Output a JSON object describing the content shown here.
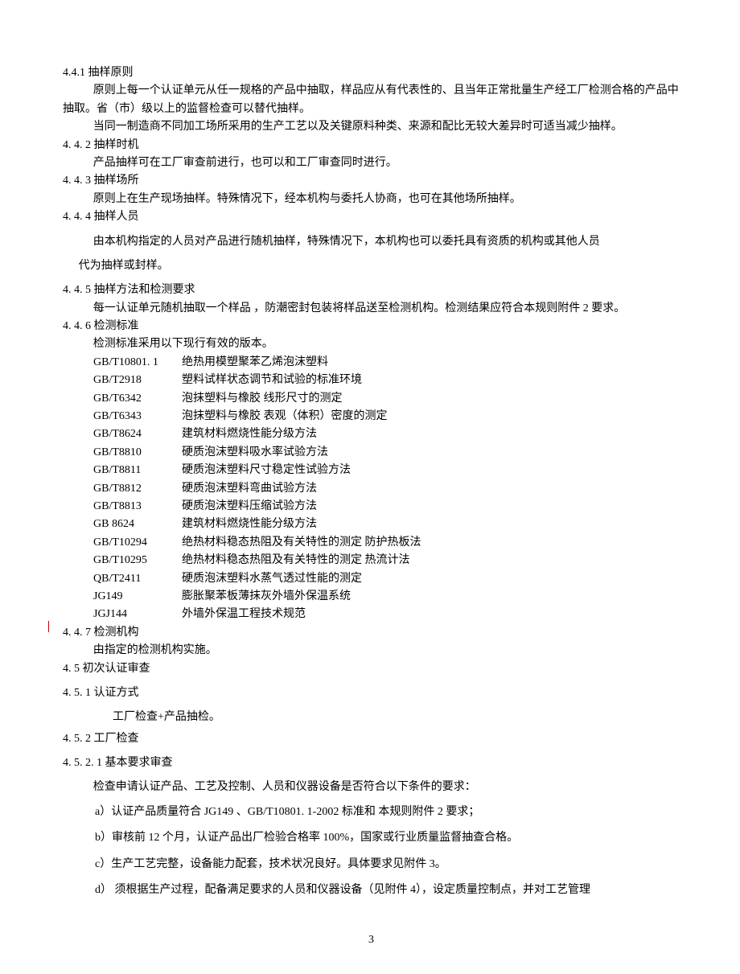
{
  "s441": {
    "heading": "4.4.1 抽样原则",
    "p1": "原则上每一个认证单元从任一规格的产品中抽取，样品应从有代表性的、且当年正常批量生产经工厂检测合格的产品中抽取。省（市）级以上的监督检查可以替代抽样。",
    "p2": "当同一制造商不同加工场所采用的生产工艺以及关键原料种类、来源和配比无较大差异时可适当减少抽样。"
  },
  "s442": {
    "heading": "4. 4. 2 抽样时机",
    "p1": "产品抽样可在工厂审查前进行，也可以和工厂审查同时进行。"
  },
  "s443": {
    "heading": "4. 4. 3  抽样场所",
    "p1": "原则上在生产现场抽样。特殊情况下，经本机构与委托人协商，也可在其他场所抽样。"
  },
  "s444": {
    "heading": "4. 4. 4 抽样人员",
    "p1": "由本机构指定的人员对产品进行随机抽样，特殊情况下，本机构也可以委托具有资质的机构或其他人员",
    "p2": "代为抽样或封样。"
  },
  "s445": {
    "heading": "4. 4. 5 抽样方法和检测要求",
    "p1": "每一认证单元随机抽取一个样品 ，防潮密封包装将样品送至检测机构。检测结果应符合本规则附件 2 要求。"
  },
  "s446": {
    "heading": "4. 4. 6 检测标准",
    "intro": "检测标准采用以下现行有效的版本。",
    "standards": [
      {
        "code": "GB/T10801. 1",
        "title": "绝热用模塑聚苯乙烯泡沫塑料"
      },
      {
        "code": "GB/T2918",
        "title": "塑料试样状态调节和试验的标准环境"
      },
      {
        "code": "GB/T6342",
        "title": "泡抹塑料与橡胶  线形尺寸的测定"
      },
      {
        "code": "GB/T6343",
        "title": "泡抹塑料与橡胶  表观（体积）密度的测定"
      },
      {
        "code": "GB/T8624",
        "title": "建筑材料燃烧性能分级方法"
      },
      {
        "code": "GB/T8810",
        "title": "硬质泡沫塑料吸水率试验方法"
      },
      {
        "code": "GB/T8811",
        "title": "硬质泡沫塑料尺寸稳定性试验方法"
      },
      {
        "code": "GB/T8812",
        "title": "硬质泡沫塑料弯曲试验方法"
      },
      {
        "code": "GB/T8813",
        "title": "硬质泡沫塑料压缩试验方法"
      },
      {
        "code": "GB 8624",
        "title": "建筑材料燃烧性能分级方法"
      },
      {
        "code": "GB/T10294",
        "title": "绝热材料稳态热阻及有关特性的测定  防护热板法"
      },
      {
        "code": "GB/T10295",
        "title": "绝热材料稳态热阻及有关特性的测定  热流计法"
      },
      {
        "code": "QB/T2411",
        "title": "硬质泡沫塑料水蒸气透过性能的测定"
      },
      {
        "code": "JG149",
        "title": "膨胀聚苯板薄抹灰外墙外保温系统"
      },
      {
        "code": "JGJ144",
        "title": "外墙外保温工程技术规范"
      }
    ]
  },
  "s447": {
    "heading": "4. 4. 7 检测机构",
    "p1": "由指定的检测机构实施。"
  },
  "s45": {
    "heading": "4. 5 初次认证审查"
  },
  "s451": {
    "heading": "4. 5. 1  认证方式",
    "p1": "工厂检查+产品抽检。"
  },
  "s452": {
    "heading": "4. 5. 2 工厂检查"
  },
  "s4521": {
    "heading": "4. 5. 2. 1 基本要求审查",
    "p1": "检查申请认证产品、工艺及控制、人员和仪器设备是否符合以下条件的要求：",
    "items": [
      "a）认证产品质量符合 JG149 、GB/T10801. 1-2002 标准和  本规则附件 2 要求；",
      "b）审核前 12 个月，认证产品出厂检验合格率 100%，国家或行业质量监督抽查合格。",
      "c）生产工艺完整，设备能力配套，技术状况良好。具体要求见附件 3。",
      "d） 须根据生产过程，配备满足要求的人员和仪器设备（见附件 4），设定质量控制点，并对工艺管理"
    ]
  },
  "pageNumber": "3"
}
